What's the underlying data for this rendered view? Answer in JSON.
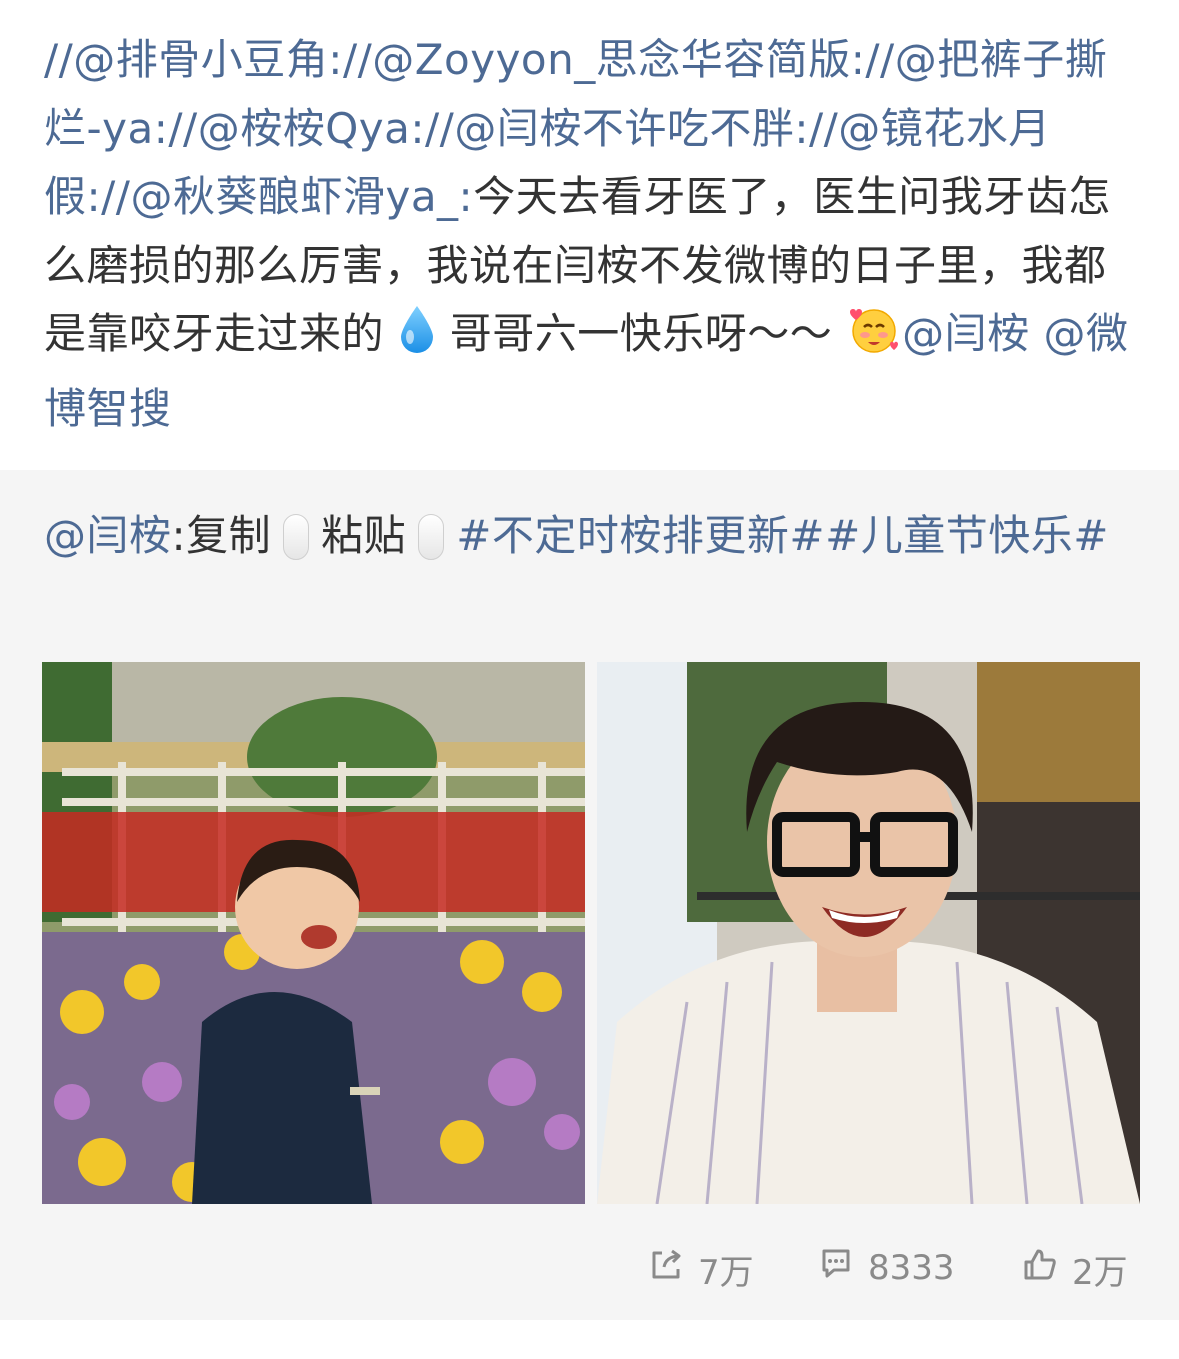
{
  "post": {
    "mentions": [
      "//@排骨小豆角:",
      "//@Zoyyon_思念华容简版:",
      "//@把裤子撕烂-ya:",
      "//@桉桉Qya:",
      "//@闫桉不许吃不胖:",
      "//@镜花水月假:",
      "//@秋葵酿虾滑ya_:"
    ],
    "body_part1": "今天去看牙医了，医生问我牙齿怎么磨损的那么厉害，我说在闫桉不发微博的日子里，我都是靠咬牙走过来的",
    "body_part2": " 哥哥六一快乐呀～～",
    "tail_mentions": [
      "@闫桉",
      " @微博智搜"
    ],
    "emoji_drop": "droplet-emoji",
    "emoji_face": "shy-hearts-emoji"
  },
  "repost": {
    "author": "@闫桉",
    "text_a": ":复制",
    "text_b": "粘贴",
    "topics": "#不定时桉排更新##儿童节快乐#",
    "key_icon": "paste-key-icon"
  },
  "photos": [
    {
      "name": "child-photo",
      "alt": ""
    },
    {
      "name": "adult-photo",
      "alt": ""
    }
  ],
  "actions": {
    "repost_count": "7万",
    "comment_count": "8333",
    "like_count": "2万"
  },
  "colors": {
    "link": "#4d6a94",
    "text": "#333333",
    "repost_bg": "#f5f5f5",
    "meta": "#8a8a8a"
  }
}
